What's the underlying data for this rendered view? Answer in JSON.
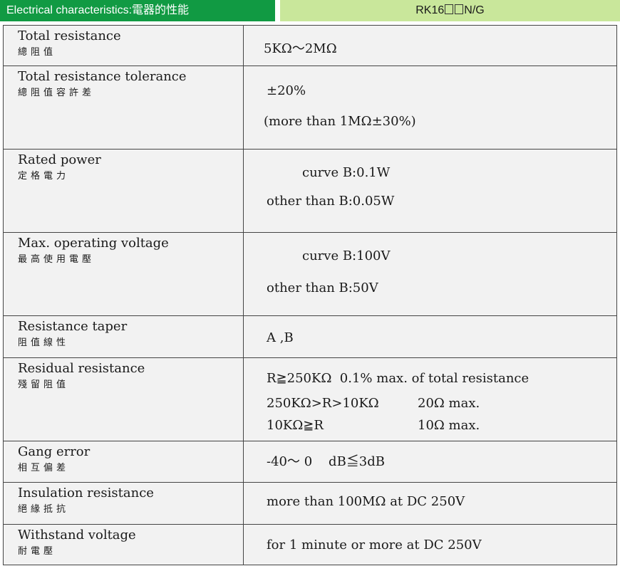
{
  "header": {
    "left_title": "Electrical characteristics:電器的性能",
    "right_title_prefix": "RK16",
    "right_title_suffix": "N/G"
  },
  "rows": [
    {
      "label_en": "Total resistance",
      "label_zh": "總阻值",
      "lines": [
        "5KΩ～2MΩ"
      ]
    },
    {
      "label_en": "Total resistance tolerance",
      "label_zh": "總阻值容許差",
      "lines": [
        "±20%",
        "(more than 1MΩ±30%)"
      ]
    },
    {
      "label_en": "Rated power",
      "label_zh": "定格電力",
      "lines": [
        "curve B:0.1W",
        "other than B:0.05W"
      ]
    },
    {
      "label_en": "Max. operating voltage",
      "label_zh": "最高使用電壓",
      "lines": [
        "curve B:100V",
        "other than B:50V"
      ]
    },
    {
      "label_en": "Resistance taper",
      "label_zh": "阻值線性",
      "lines": [
        "A ,B"
      ]
    },
    {
      "label_en": "Residual resistance",
      "label_zh": "殘留阻值",
      "lines": [
        "R≧250KΩ  0.1% max. of total resistance"
      ],
      "sub": [
        {
          "a": "250KΩ>R>10KΩ",
          "b": "20Ω max."
        },
        {
          "a": "10KΩ≧R",
          "b": "10Ω max."
        }
      ]
    },
    {
      "label_en": "Gang error",
      "label_zh": "相互偏差",
      "lines": [
        "-40～ 0    dB≦3dB"
      ]
    },
    {
      "label_en": "Insulation resistance",
      "label_zh": "絕緣抵抗",
      "lines": [
        "more than 100MΩ at DC 250V"
      ]
    },
    {
      "label_en": "Withstand voltage",
      "label_zh": "耐電壓",
      "lines": [
        "for 1 minute or more at DC 250V"
      ]
    }
  ]
}
